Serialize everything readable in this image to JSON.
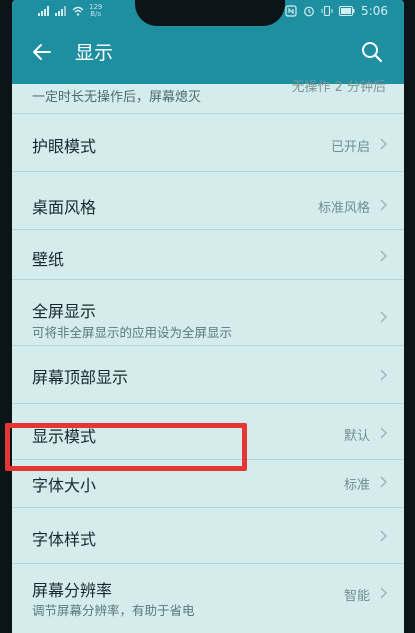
{
  "status_bar": {
    "network": "4G",
    "net_speed": "129\nB/s",
    "time": "5:06"
  },
  "header": {
    "title": "显示"
  },
  "partial_row": {
    "description": "一定时长无操作后，屏幕熄灭",
    "value": "无操作 2 分钟后"
  },
  "rows": [
    {
      "label": "护眼模式",
      "sub": "",
      "value": "已开启"
    },
    {
      "label": "桌面风格",
      "sub": "",
      "value": "标准风格"
    },
    {
      "label": "壁纸",
      "sub": "",
      "value": ""
    },
    {
      "label": "全屏显示",
      "sub": "可将非全屏显示的应用设为全屏显示",
      "value": ""
    },
    {
      "label": "屏幕顶部显示",
      "sub": "",
      "value": ""
    },
    {
      "label": "显示模式",
      "sub": "",
      "value": "默认"
    },
    {
      "label": "字体大小",
      "sub": "",
      "value": "标准"
    },
    {
      "label": "字体样式",
      "sub": "",
      "value": ""
    },
    {
      "label": "屏幕分辨率",
      "sub": "调节屏幕分辨率，有助于省电",
      "value": "智能"
    }
  ],
  "colors": {
    "header": "#1d8fa1",
    "background": "#d5ecec",
    "highlight": "#e53535"
  }
}
